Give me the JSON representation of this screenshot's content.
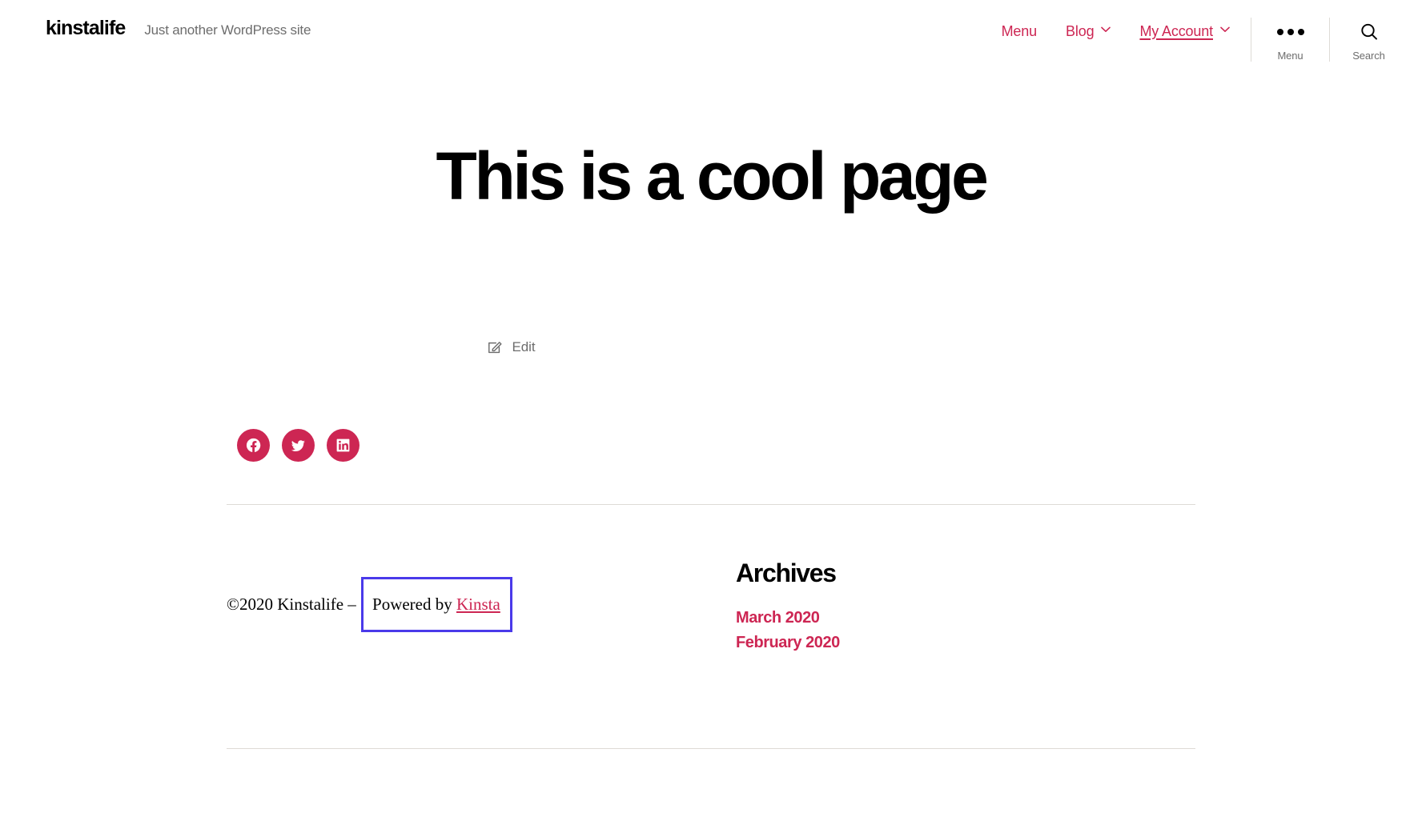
{
  "header": {
    "site_title": "kinstalife",
    "tagline": "Just another WordPress site",
    "nav": [
      {
        "label": "Menu",
        "has_dropdown": false,
        "current": false
      },
      {
        "label": "Blog",
        "has_dropdown": true,
        "current": false
      },
      {
        "label": "My Account",
        "has_dropdown": true,
        "current": true
      }
    ],
    "menu_button": {
      "label": "Menu",
      "icon": "three-dots-icon"
    },
    "search_button": {
      "label": "Search",
      "icon": "search-icon"
    }
  },
  "page": {
    "title": "This is a cool page",
    "edit_link": {
      "label": "Edit",
      "icon": "edit-pencil-icon"
    }
  },
  "social": [
    {
      "name": "Facebook",
      "icon": "facebook-icon"
    },
    {
      "name": "Twitter",
      "icon": "twitter-icon"
    },
    {
      "name": "LinkedIn",
      "icon": "linkedin-icon"
    }
  ],
  "footer": {
    "copyright": "©2020 Kinstalife – ",
    "powered_prefix": "Powered by ",
    "powered_link": "Kinsta",
    "highlight_color": "#4a3aea"
  },
  "widget": {
    "title": "Archives",
    "links": [
      "March 2020",
      "February 2020"
    ]
  },
  "colors": {
    "accent": "#cd2653",
    "text": "#000000",
    "muted": "#6d6d6d",
    "rule": "#dedbd6"
  }
}
